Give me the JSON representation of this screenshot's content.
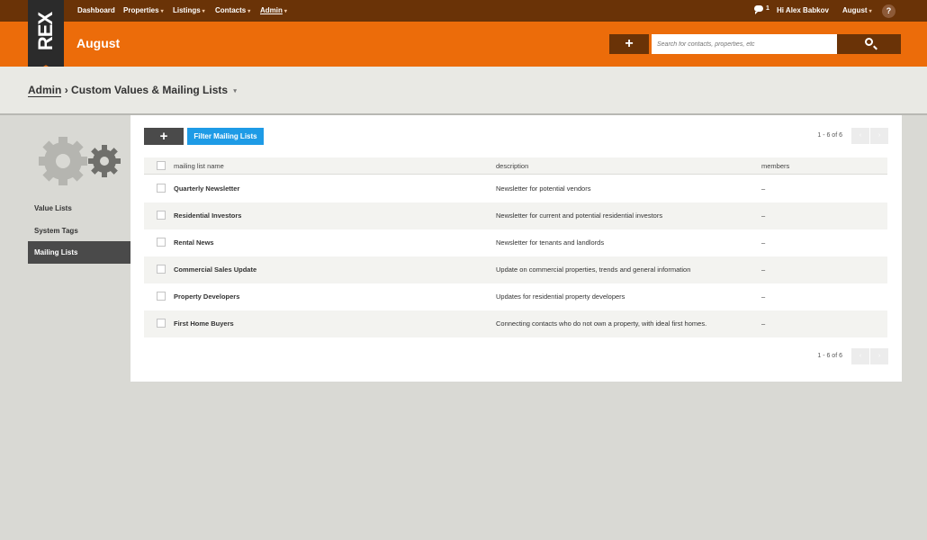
{
  "nav": {
    "items": [
      {
        "label": "Dashboard",
        "caret": ""
      },
      {
        "label": "Properties",
        "caret": "▾"
      },
      {
        "label": "Listings",
        "caret": "▾"
      },
      {
        "label": "Contacts",
        "caret": "▾"
      },
      {
        "label": "Admin",
        "caret": "▾"
      }
    ],
    "chat_count": "1",
    "greeting": "Hi Alex Babkov",
    "account_menu": "August",
    "account_caret": "▾",
    "help": "?"
  },
  "logo": "REX",
  "header": {
    "account_title": "August",
    "add_label": "+",
    "search_placeholder": "Search for contacts, properties, etc"
  },
  "breadcrumb": {
    "root": "Admin",
    "separator": "›",
    "current": "Custom Values & Mailing Lists",
    "caret": "▾"
  },
  "sidebar": {
    "items": [
      {
        "label": "Value Lists"
      },
      {
        "label": "System Tags"
      },
      {
        "label": "Mailing Lists"
      }
    ],
    "active_index": 2
  },
  "toolbar": {
    "add_label": "+",
    "filter_label": "Filter Mailing Lists"
  },
  "pagination": {
    "text": "1 - 6 of 6",
    "prev": "‹",
    "next": "›"
  },
  "table": {
    "columns": [
      "mailing list name",
      "description",
      "members"
    ],
    "rows": [
      {
        "name": "Quarterly Newsletter",
        "description": "Newsletter for potential vendors",
        "members": "–"
      },
      {
        "name": "Residential Investors",
        "description": "Newsletter for current and potential residential investors",
        "members": "–"
      },
      {
        "name": "Rental News",
        "description": "Newsletter for tenants and landlords",
        "members": "–"
      },
      {
        "name": "Commercial Sales Update",
        "description": "Update on commercial properties, trends and general information",
        "members": "–"
      },
      {
        "name": "Property Developers",
        "description": "Updates for residential property developers",
        "members": "–"
      },
      {
        "name": "First Home Buyers",
        "description": "Connecting contacts who do not own a property, with ideal first homes.",
        "members": "–"
      }
    ]
  },
  "colors": {
    "nav_bg": "#6a3307",
    "brand_orange": "#ec6c0a",
    "filter_blue": "#1e9be6",
    "sidebar_active": "#4a4a4a"
  },
  "icons": {
    "gear": "gear-icon",
    "search": "search-icon",
    "chat": "chat-bubble-icon",
    "help": "help-icon"
  }
}
